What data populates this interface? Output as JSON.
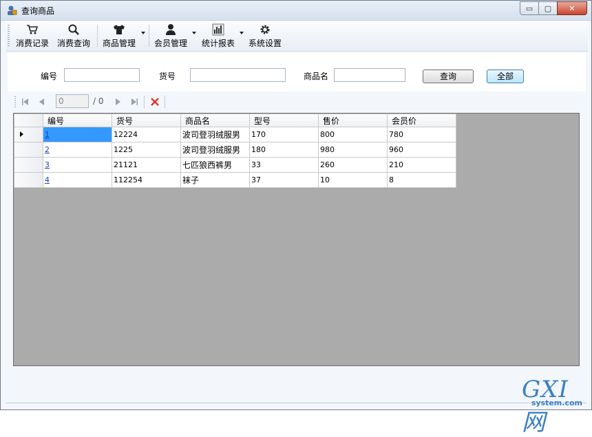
{
  "window": {
    "title": "查询商品",
    "controls": {
      "minimize": "▭",
      "maximize": "▢",
      "close": "✕"
    }
  },
  "toolbar": {
    "items": [
      {
        "label": "消费记录",
        "icon": "cart-icon"
      },
      {
        "label": "消费查询",
        "icon": "search-icon"
      },
      {
        "label": "商品管理",
        "icon": "shirt-icon",
        "dropdown": true
      },
      {
        "label": "会员管理",
        "icon": "user-icon",
        "dropdown": true
      },
      {
        "label": "统计报表",
        "icon": "chart-icon",
        "dropdown": true
      },
      {
        "label": "系统设置",
        "icon": "gear-icon"
      }
    ]
  },
  "filter": {
    "id_label": "编号",
    "id_value": "",
    "sku_label": "货号",
    "sku_value": "",
    "name_label": "商品名",
    "name_value": "",
    "query_button": "查询",
    "all_button": "全部"
  },
  "navigator": {
    "position": "0",
    "count_text": "/ 0"
  },
  "grid": {
    "columns": [
      "编号",
      "货号",
      "商品名",
      "型号",
      "售价",
      "会员价"
    ],
    "rows": [
      [
        "1",
        "12224",
        "波司登羽绒服男",
        "170",
        "800",
        "780"
      ],
      [
        "2",
        "1225",
        "波司登羽绒服男",
        "180",
        "980",
        "960"
      ],
      [
        "3",
        "21121",
        "七匹狼西裤男",
        "33",
        "260",
        "210"
      ],
      [
        "4",
        "112254",
        "袜子",
        "37",
        "10",
        "8"
      ]
    ],
    "selected_row": 0
  },
  "watermark": {
    "big": "GXI网",
    "small": "system.com"
  },
  "colors": {
    "selection": "#3399ff",
    "grid_background": "#ababab",
    "link": "#1a3fb5"
  }
}
